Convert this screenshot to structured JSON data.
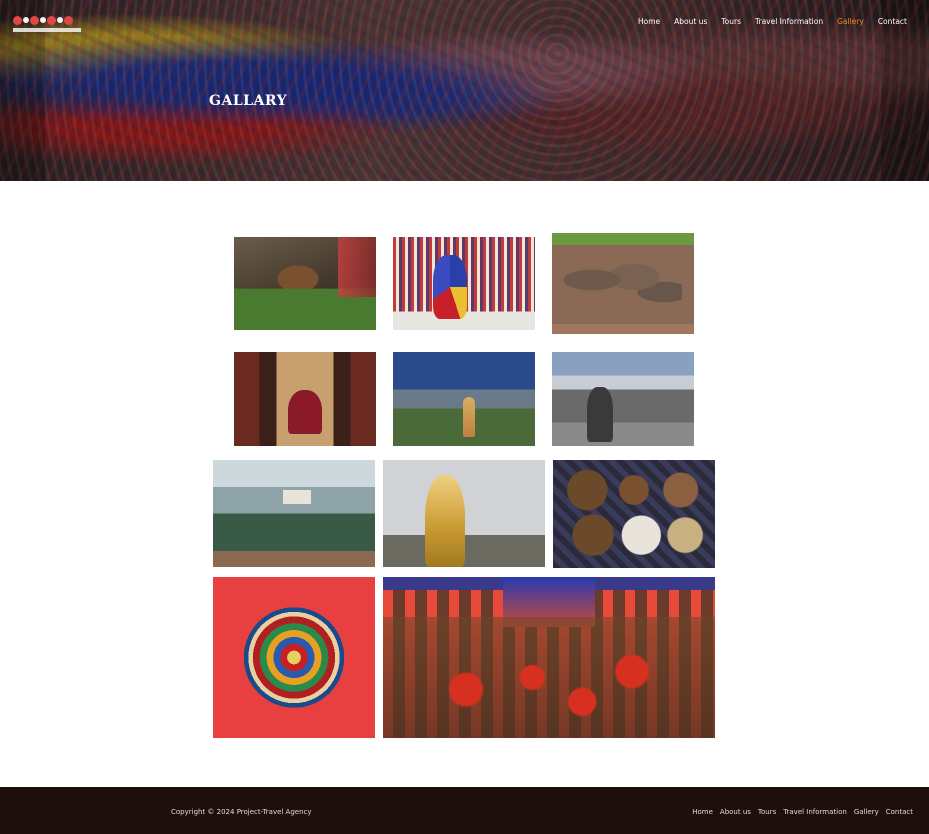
{
  "header": {
    "nav": [
      "Home",
      "About us",
      "Tours",
      "Travel Information",
      "Gallery",
      "Contact"
    ],
    "active_nav": "Gallery",
    "active_color": "#f0892b"
  },
  "hero": {
    "title": "GALLARY"
  },
  "gallery": {
    "images": [
      {
        "icon": "monastery-cliff-image"
      },
      {
        "icon": "masked-dancer-image"
      },
      {
        "icon": "elephant-herd-image"
      },
      {
        "icon": "monk-meditating-image"
      },
      {
        "icon": "buddha-valley-image"
      },
      {
        "icon": "trekker-mountain-image"
      },
      {
        "icon": "misty-village-image"
      },
      {
        "icon": "golden-statue-image"
      },
      {
        "icon": "food-bowls-image"
      },
      {
        "icon": "mandala-painting-image"
      },
      {
        "icon": "temple-interior-image"
      }
    ]
  },
  "footer": {
    "copyright": "Copyright © 2024 Project-Travel Agency",
    "nav": [
      "Home",
      "About us",
      "Tours",
      "Travel Information",
      "Gallery",
      "Contact"
    ],
    "background": "#1e0f0c"
  }
}
